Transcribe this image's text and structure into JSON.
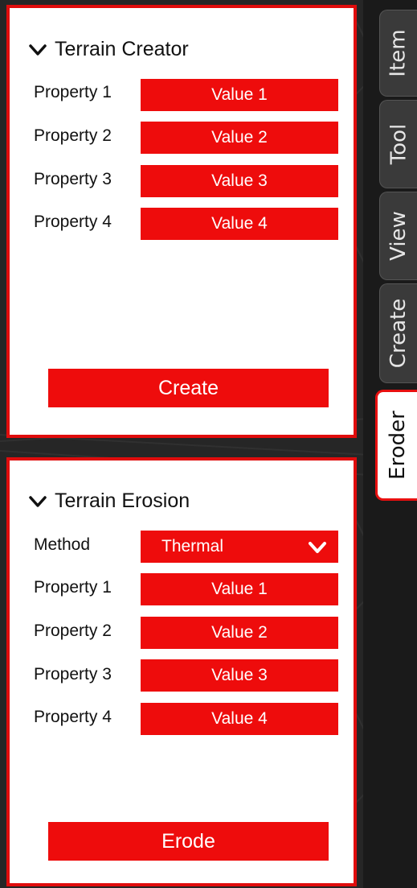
{
  "tabs": [
    "Item",
    "Tool",
    "View",
    "Create",
    "Eroder"
  ],
  "creator": {
    "title": "Terrain Creator",
    "properties": [
      {
        "label": "Property 1",
        "value": "Value 1"
      },
      {
        "label": "Property 2",
        "value": "Value 2"
      },
      {
        "label": "Property 3",
        "value": "Value 3"
      },
      {
        "label": "Property 4",
        "value": "Value 4"
      }
    ],
    "button": "Create"
  },
  "erosion": {
    "title": "Terrain Erosion",
    "method_label": "Method",
    "method_value": "Thermal",
    "properties": [
      {
        "label": "Property 1",
        "value": "Value 1"
      },
      {
        "label": "Property 2",
        "value": "Value 2"
      },
      {
        "label": "Property 3",
        "value": "Value 3"
      },
      {
        "label": "Property 4",
        "value": "Value 4"
      }
    ],
    "button": "Erode"
  },
  "colors": {
    "accent": "#ee0c0c",
    "panel_border": "#e00c0c",
    "panel_bg": "#ffffff",
    "tab_bg": "#3a3a3a"
  },
  "icons": {
    "collapse": "chevron-down-icon",
    "dropdown": "chevron-down-icon"
  }
}
